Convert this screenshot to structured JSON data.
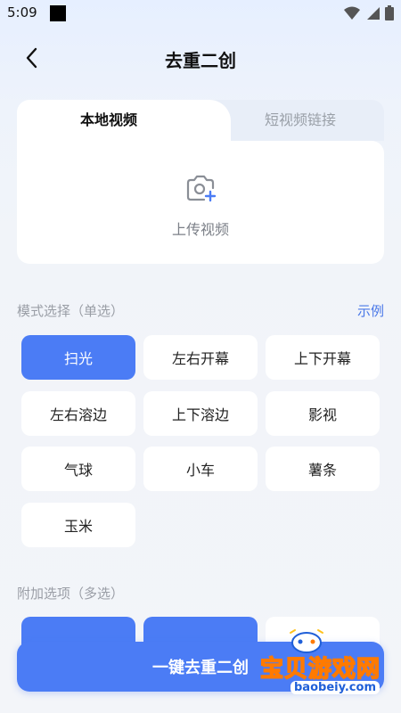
{
  "status": {
    "time": "5:09"
  },
  "header": {
    "title": "去重二创"
  },
  "tabs": {
    "local": "本地视频",
    "link": "短视频链接"
  },
  "upload": {
    "label": "上传视频"
  },
  "mode": {
    "title": "模式选择（单选）",
    "example": "示例",
    "options": [
      "扫光",
      "左右开幕",
      "上下开幕",
      "左右溶边",
      "上下溶边",
      "影视",
      "气球",
      "小车",
      "薯条",
      "玉米"
    ],
    "selected": "扫光"
  },
  "extra": {
    "title": "附加选项（多选）"
  },
  "submit": {
    "label": "一键去重二创"
  },
  "watermark": {
    "text": "宝贝游戏网",
    "url": "baobeiy.com"
  },
  "colors": {
    "accent": "#4b7cf5",
    "link": "#4a78e8"
  }
}
